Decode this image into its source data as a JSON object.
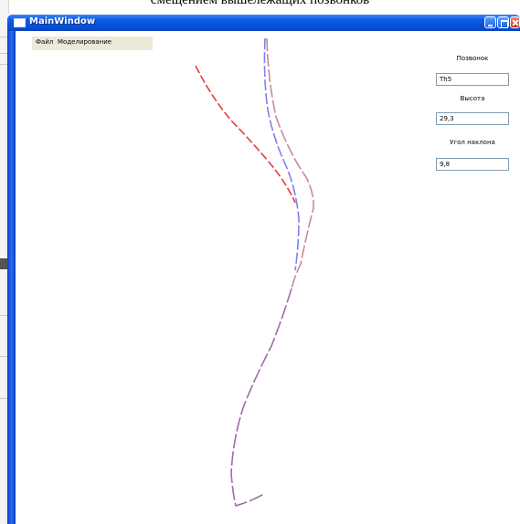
{
  "caption": "смещением вышележащих позвонков",
  "window": {
    "title": "MainWindow"
  },
  "menu": {
    "items": [
      "Файл",
      "Моделирование"
    ]
  },
  "fields": {
    "vertebra_label": "Позвонок",
    "vertebra_value": "Th5",
    "height_label": "Высота",
    "height_value": "29,3",
    "angle_label": "Угол наклона",
    "angle_value": "9,8"
  },
  "colors": {
    "curve_red": "#e83a3a",
    "curve_blue": "#7f7ff0",
    "curve_pink": "#c98a9a",
    "curve_purple": "#a06aa8",
    "title_bar": "#0b5ee6"
  }
}
